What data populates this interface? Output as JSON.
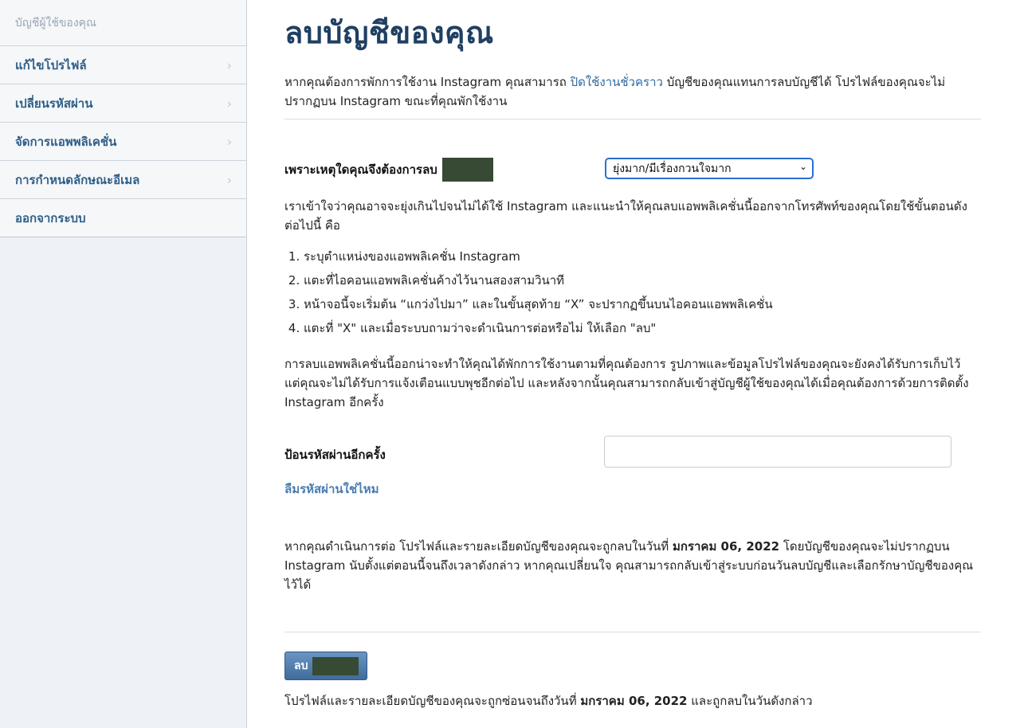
{
  "sidebar": {
    "header": "บัญชีผู้ใช้ของคุณ",
    "items": [
      {
        "label": "แก้ไขโปรไฟล์",
        "chevron": "›"
      },
      {
        "label": "เปลี่ยนรหัสผ่าน",
        "chevron": "›"
      },
      {
        "label": "จัดการแอพพลิเคชั่น",
        "chevron": "›"
      },
      {
        "label": "การกำหนดลักษณะอีเมล",
        "chevron": "›"
      },
      {
        "label": "ออกจากระบบ"
      }
    ]
  },
  "main": {
    "title": "ลบบัญชีของคุณ",
    "intro_pre": "หากคุณต้องการพักการใช้งาน Instagram คุณสามารถ ",
    "intro_link": "ปิดใช้งานชั่วคราว",
    "intro_post": " บัญชีของคุณแทนการลบบัญชีได้ โปรไฟล์ของคุณจะไม่ปรากฏบน Instagram ขณะที่คุณพักใช้งาน",
    "reason_label": "เพราะเหตุใดคุณจึงต้องการลบ",
    "reason_selected": "ยุ่งมาก/มีเรื่องกวนใจมาก",
    "help_text": "เราเข้าใจว่าคุณอาจจะยุ่งเกินไปจนไม่ได้ใช้ Instagram และแนะนำให้คุณลบแอพพลิเคชั่นนี้ออกจากโทรศัพท์ของคุณโดยใช้ขั้นตอนดังต่อไปนี้ คือ",
    "steps": [
      "ระบุตำแหน่งของแอพพลิเคชั่น Instagram",
      "แตะที่ไอคอนแอพพลิเคชั่นค้างไว้นานสองสามวินาที",
      "หน้าจอนี้จะเริ่มต้น “แกว่งไปมา” และในขั้นสุดท้าย “X” จะปรากฏขึ้นบนไอคอนแอพพลิเคชั่น",
      "แตะที่ \"X\" และเมื่อระบบถามว่าจะดำเนินการต่อหรือไม่ ให้เลือก \"ลบ\""
    ],
    "info_text": "การลบแอพพลิเคชั่นนี้ออกน่าจะทำให้คุณได้พักการใช้งานตามที่คุณต้องการ รูปภาพและข้อมูลโปรไฟล์ของคุณจะยังคงได้รับการเก็บไว้ แต่คุณจะไม่ได้รับการแจ้งเตือนแบบพุชอีกต่อไป และหลังจากนั้นคุณสามารถกลับเข้าสู่บัญชีผู้ใช้ของคุณได้เมื่อคุณต้องการด้วยการติดตั้ง Instagram อีกครั้ง",
    "password_label": "ป้อนรหัสผ่านอีกครั้ง",
    "forgot_link": "ลืมรหัสผ่านใช่ไหม",
    "deadline_pre": "หากคุณดำเนินการต่อ โปรไฟล์และรายละเอียดบัญชีของคุณจะถูกลบในวันที่ ",
    "deadline_date": "มกราคม 06, 2022",
    "deadline_post": " โดยบัญชีของคุณจะไม่ปรากฏบน Instagram นับตั้งแต่ตอนนี้จนถึงเวลาดังกล่าว หากคุณเปลี่ยนใจ คุณสามารถกลับเข้าสู่ระบบก่อนวันลบบัญชีและเลือกรักษาบัญชีของคุณไว้ได้",
    "delete_button": "ลบ",
    "footer_pre": "โปรไฟล์และรายละเอียดบัญชีของคุณจะถูกซ่อนจนถึงวันที่ ",
    "footer_date": "มกราคม 06, 2022",
    "footer_post": " และถูกลบในวันดังกล่าว"
  },
  "colors": {
    "title": "#1f3f63",
    "link": "#2f6aa0",
    "sidebar_bg": "#eef1f5",
    "button": "#4f7fb0",
    "redaction": "#364a34"
  }
}
